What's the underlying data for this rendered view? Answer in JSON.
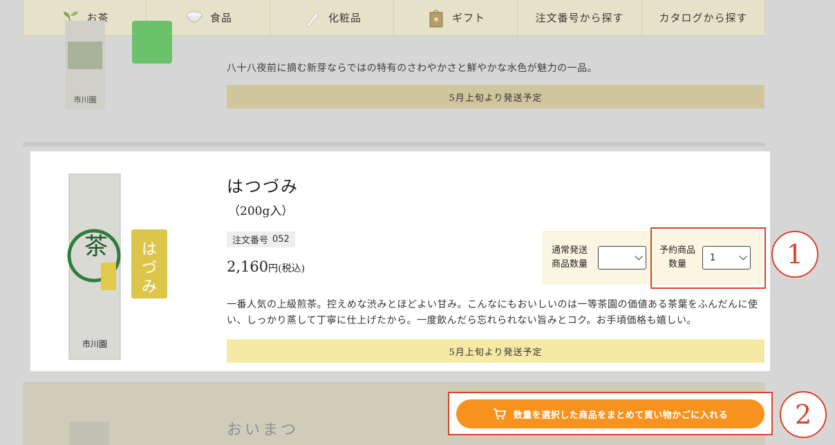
{
  "nav": {
    "items": [
      {
        "label": "お茶",
        "icon": "tea-leaf-icon"
      },
      {
        "label": "食品",
        "icon": "bowl-icon"
      },
      {
        "label": "化粧品",
        "icon": "cosmetic-tube-icon"
      },
      {
        "label": "ギフト",
        "icon": "gift-bag-icon"
      },
      {
        "label": "注文番号から探す",
        "icon": ""
      },
      {
        "label": "カタログから探す",
        "icon": ""
      }
    ]
  },
  "prev_product": {
    "description": "八十八夜前に摘む新芽ならではの特有のさわやかさと鮮やかな水色が魅力の一品。",
    "shipping": "5月上旬より発送予定"
  },
  "product": {
    "name": "はつづみ",
    "size": "（200g入）",
    "code_label": "注文番号",
    "code": "052",
    "price": "2,160",
    "price_unit": "円(税込)",
    "description": "一番人気の上級煎茶。控えめな渋みとほどよい甘み。こんなにもおいしいのは一等茶園の価値ある茶葉をふんだんに使い、しっかり蒸して丁寧に仕上げたから。一度飲んだら忘れられない旨みとコク。お手頃価格も嬉しい。",
    "shipping": "5月上旬より発送予定",
    "normal_qty_label_1": "通常発送",
    "normal_qty_label_2": "商品数量",
    "normal_qty_value": "",
    "reserve_qty_label_1": "予約商品",
    "reserve_qty_label_2": "数量",
    "reserve_qty_value": "1"
  },
  "next_product": {
    "name": "おいまつ"
  },
  "cart_button": {
    "label": "数量を選択した商品をまとめて買い物かごに入れる"
  },
  "annotations": {
    "marker1": "1",
    "marker2": "2"
  },
  "colors": {
    "accent_orange": "#f7921e",
    "highlight_red": "#d9432b",
    "shipping_bar": "#f5e9a6",
    "nav_bg": "#e6e1c9"
  }
}
